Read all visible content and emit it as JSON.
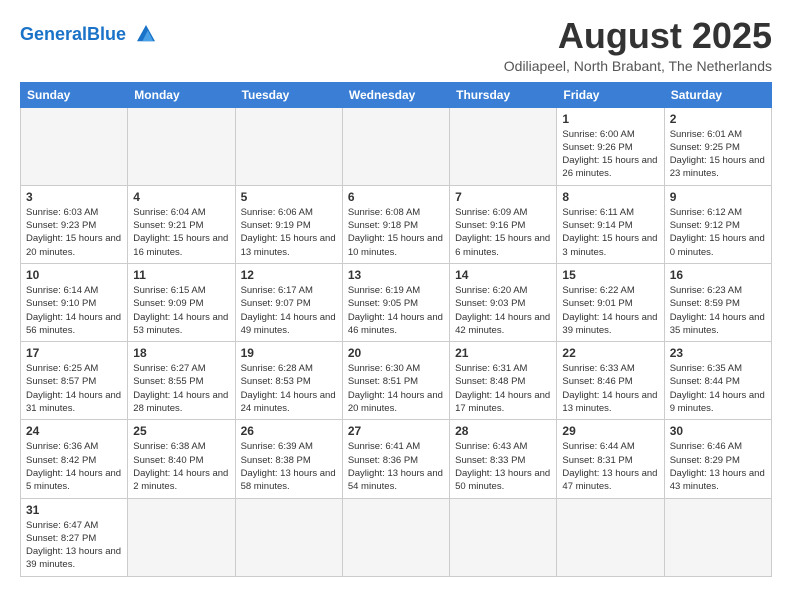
{
  "header": {
    "logo_general": "General",
    "logo_blue": "Blue",
    "title": "August 2025",
    "subtitle": "Odiliapeel, North Brabant, The Netherlands"
  },
  "days_of_week": [
    "Sunday",
    "Monday",
    "Tuesday",
    "Wednesday",
    "Thursday",
    "Friday",
    "Saturday"
  ],
  "weeks": [
    [
      {
        "day": "",
        "info": ""
      },
      {
        "day": "",
        "info": ""
      },
      {
        "day": "",
        "info": ""
      },
      {
        "day": "",
        "info": ""
      },
      {
        "day": "",
        "info": ""
      },
      {
        "day": "1",
        "info": "Sunrise: 6:00 AM\nSunset: 9:26 PM\nDaylight: 15 hours and 26 minutes."
      },
      {
        "day": "2",
        "info": "Sunrise: 6:01 AM\nSunset: 9:25 PM\nDaylight: 15 hours and 23 minutes."
      }
    ],
    [
      {
        "day": "3",
        "info": "Sunrise: 6:03 AM\nSunset: 9:23 PM\nDaylight: 15 hours and 20 minutes."
      },
      {
        "day": "4",
        "info": "Sunrise: 6:04 AM\nSunset: 9:21 PM\nDaylight: 15 hours and 16 minutes."
      },
      {
        "day": "5",
        "info": "Sunrise: 6:06 AM\nSunset: 9:19 PM\nDaylight: 15 hours and 13 minutes."
      },
      {
        "day": "6",
        "info": "Sunrise: 6:08 AM\nSunset: 9:18 PM\nDaylight: 15 hours and 10 minutes."
      },
      {
        "day": "7",
        "info": "Sunrise: 6:09 AM\nSunset: 9:16 PM\nDaylight: 15 hours and 6 minutes."
      },
      {
        "day": "8",
        "info": "Sunrise: 6:11 AM\nSunset: 9:14 PM\nDaylight: 15 hours and 3 minutes."
      },
      {
        "day": "9",
        "info": "Sunrise: 6:12 AM\nSunset: 9:12 PM\nDaylight: 15 hours and 0 minutes."
      }
    ],
    [
      {
        "day": "10",
        "info": "Sunrise: 6:14 AM\nSunset: 9:10 PM\nDaylight: 14 hours and 56 minutes."
      },
      {
        "day": "11",
        "info": "Sunrise: 6:15 AM\nSunset: 9:09 PM\nDaylight: 14 hours and 53 minutes."
      },
      {
        "day": "12",
        "info": "Sunrise: 6:17 AM\nSunset: 9:07 PM\nDaylight: 14 hours and 49 minutes."
      },
      {
        "day": "13",
        "info": "Sunrise: 6:19 AM\nSunset: 9:05 PM\nDaylight: 14 hours and 46 minutes."
      },
      {
        "day": "14",
        "info": "Sunrise: 6:20 AM\nSunset: 9:03 PM\nDaylight: 14 hours and 42 minutes."
      },
      {
        "day": "15",
        "info": "Sunrise: 6:22 AM\nSunset: 9:01 PM\nDaylight: 14 hours and 39 minutes."
      },
      {
        "day": "16",
        "info": "Sunrise: 6:23 AM\nSunset: 8:59 PM\nDaylight: 14 hours and 35 minutes."
      }
    ],
    [
      {
        "day": "17",
        "info": "Sunrise: 6:25 AM\nSunset: 8:57 PM\nDaylight: 14 hours and 31 minutes."
      },
      {
        "day": "18",
        "info": "Sunrise: 6:27 AM\nSunset: 8:55 PM\nDaylight: 14 hours and 28 minutes."
      },
      {
        "day": "19",
        "info": "Sunrise: 6:28 AM\nSunset: 8:53 PM\nDaylight: 14 hours and 24 minutes."
      },
      {
        "day": "20",
        "info": "Sunrise: 6:30 AM\nSunset: 8:51 PM\nDaylight: 14 hours and 20 minutes."
      },
      {
        "day": "21",
        "info": "Sunrise: 6:31 AM\nSunset: 8:48 PM\nDaylight: 14 hours and 17 minutes."
      },
      {
        "day": "22",
        "info": "Sunrise: 6:33 AM\nSunset: 8:46 PM\nDaylight: 14 hours and 13 minutes."
      },
      {
        "day": "23",
        "info": "Sunrise: 6:35 AM\nSunset: 8:44 PM\nDaylight: 14 hours and 9 minutes."
      }
    ],
    [
      {
        "day": "24",
        "info": "Sunrise: 6:36 AM\nSunset: 8:42 PM\nDaylight: 14 hours and 5 minutes."
      },
      {
        "day": "25",
        "info": "Sunrise: 6:38 AM\nSunset: 8:40 PM\nDaylight: 14 hours and 2 minutes."
      },
      {
        "day": "26",
        "info": "Sunrise: 6:39 AM\nSunset: 8:38 PM\nDaylight: 13 hours and 58 minutes."
      },
      {
        "day": "27",
        "info": "Sunrise: 6:41 AM\nSunset: 8:36 PM\nDaylight: 13 hours and 54 minutes."
      },
      {
        "day": "28",
        "info": "Sunrise: 6:43 AM\nSunset: 8:33 PM\nDaylight: 13 hours and 50 minutes."
      },
      {
        "day": "29",
        "info": "Sunrise: 6:44 AM\nSunset: 8:31 PM\nDaylight: 13 hours and 47 minutes."
      },
      {
        "day": "30",
        "info": "Sunrise: 6:46 AM\nSunset: 8:29 PM\nDaylight: 13 hours and 43 minutes."
      }
    ],
    [
      {
        "day": "31",
        "info": "Sunrise: 6:47 AM\nSunset: 8:27 PM\nDaylight: 13 hours and 39 minutes."
      },
      {
        "day": "",
        "info": ""
      },
      {
        "day": "",
        "info": ""
      },
      {
        "day": "",
        "info": ""
      },
      {
        "day": "",
        "info": ""
      },
      {
        "day": "",
        "info": ""
      },
      {
        "day": "",
        "info": ""
      }
    ]
  ]
}
